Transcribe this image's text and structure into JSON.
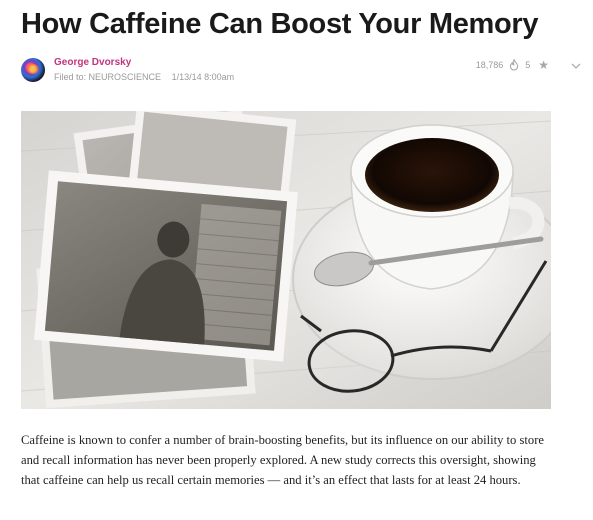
{
  "article": {
    "title": "How Caffeine Can Boost Your Memory",
    "author": "George Dvorsky",
    "filed_prefix": "Filed to:",
    "category": "NEUROSCIENCE",
    "timestamp": "1/13/14 8:00am",
    "views": "18,786",
    "reactions": "5",
    "body": "Caffeine is known to confer a number of brain-boosting benefits, but its influence on our ability to store and recall information has never been properly explored. A new study corrects this oversight, showing that caffeine can help us recall certain memories — and it’s an effect that lasts for at least 24 hours."
  },
  "icons": {
    "avatar": "author-avatar",
    "flame": "flame-icon",
    "star": "star-icon",
    "chevron": "chevron-down-icon"
  },
  "colors": {
    "author": "#c0357e",
    "meta": "#9a9a9a",
    "title": "#1a1a1a"
  }
}
